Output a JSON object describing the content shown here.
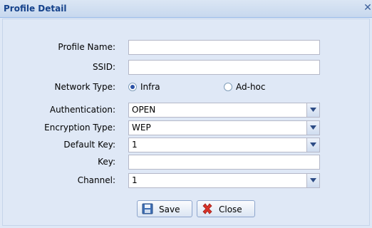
{
  "window": {
    "title": "Profile Detail",
    "close_glyph": "✕"
  },
  "form": {
    "profile_name": {
      "label": "Profile Name:",
      "value": ""
    },
    "ssid": {
      "label": "SSID:",
      "value": ""
    },
    "network_type": {
      "label": "Network Type:",
      "options": [
        "Infra",
        "Ad-hoc"
      ],
      "selected": "Infra"
    },
    "authentication": {
      "label": "Authentication:",
      "value": "OPEN"
    },
    "encryption_type": {
      "label": "Encryption Type:",
      "value": "WEP"
    },
    "default_key": {
      "label": "Default Key:",
      "value": "1"
    },
    "key": {
      "label": "Key:",
      "value": ""
    },
    "channel": {
      "label": "Channel:",
      "value": "1"
    }
  },
  "buttons": {
    "save": {
      "label": "Save",
      "icon": "floppy-disk-icon"
    },
    "close": {
      "label": "Close",
      "icon": "red-x-icon"
    }
  },
  "colors": {
    "title": "#15428b",
    "body_bg": "#dfe8f6",
    "border": "#99bbe8"
  }
}
